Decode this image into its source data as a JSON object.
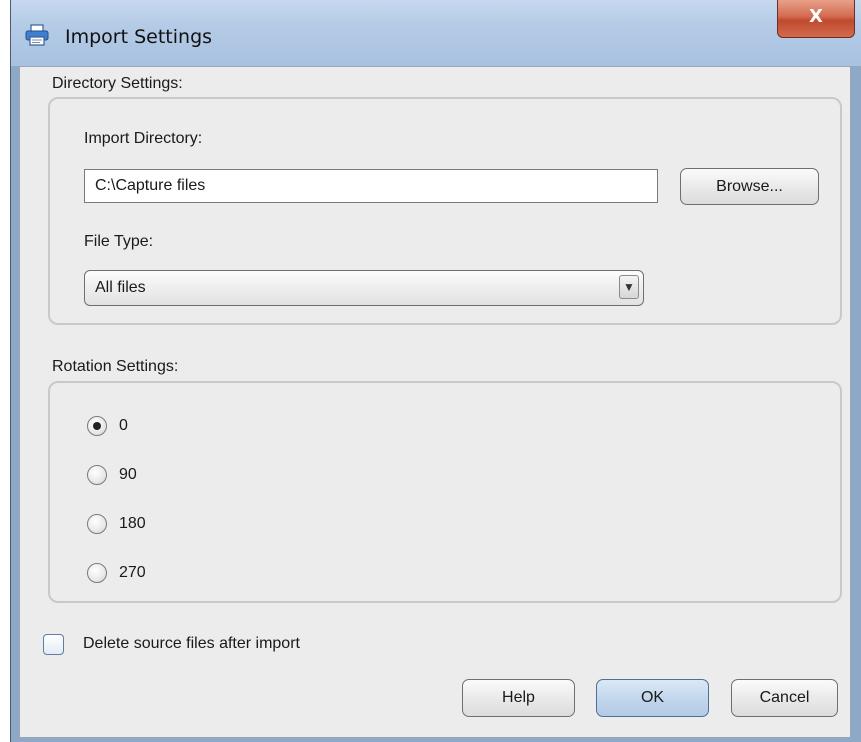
{
  "window": {
    "title": "Import Settings",
    "close_label": "X",
    "icon": "printer-icon"
  },
  "directory_settings": {
    "group_label": "Directory Settings:",
    "import_directory_label": "Import Directory:",
    "import_directory_value": "C:\\Capture files",
    "browse_label": "Browse...",
    "file_type_label": "File Type:",
    "file_type_selected": "All files"
  },
  "rotation_settings": {
    "group_label": "Rotation Settings:",
    "options": [
      "0",
      "90",
      "180",
      "270"
    ],
    "selected": "0"
  },
  "delete_source": {
    "label": "Delete source files after import",
    "checked": false
  },
  "buttons": {
    "help": "Help",
    "ok": "OK",
    "cancel": "Cancel"
  }
}
